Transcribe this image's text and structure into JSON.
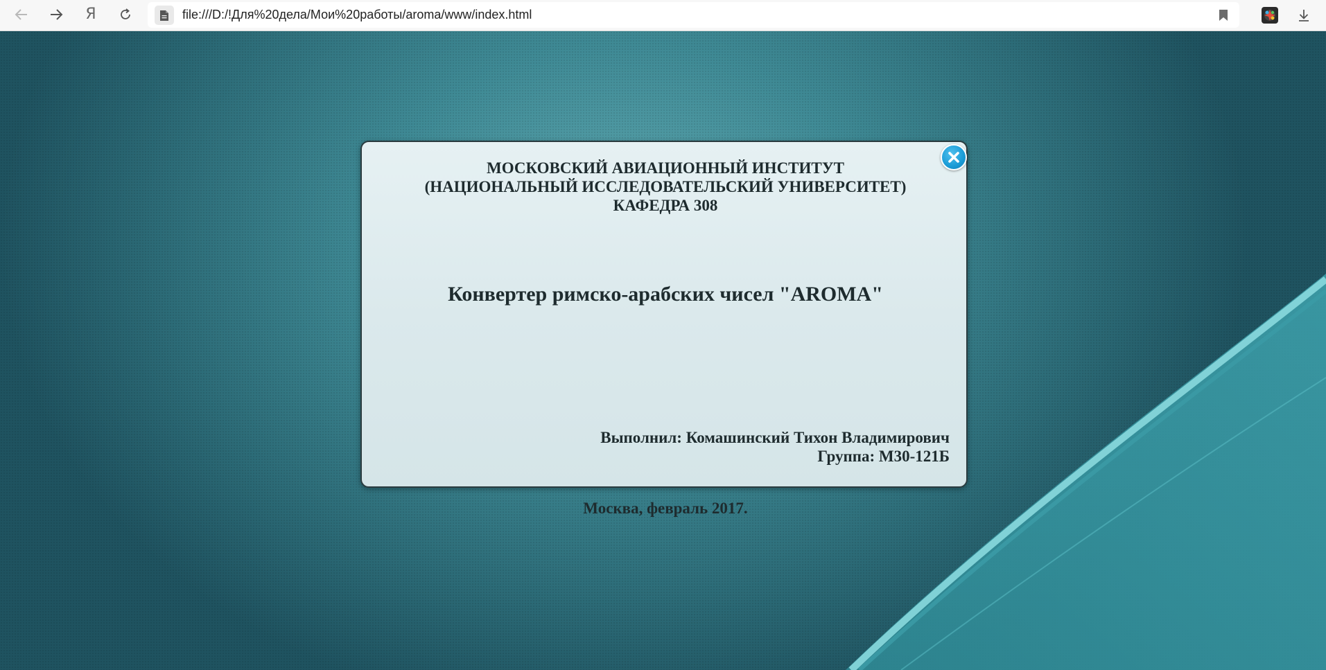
{
  "browser": {
    "url": "file:///D:/!Для%20дела/Мои%20работы/aroma/www/index.html",
    "ya_label": "Я",
    "icons": {
      "back": "arrow-left-icon",
      "forward": "arrow-right-icon",
      "reload": "reload-icon",
      "page": "file-icon",
      "bookmark": "bookmark-icon",
      "extension": "extension-icon",
      "download": "download-icon"
    }
  },
  "card": {
    "institute_line1": "МОСКОВСКИЙ АВИАЦИОННЫЙ ИНСТИТУТ",
    "institute_line2": "(НАЦИОНАЛЬНЫЙ ИССЛЕДОВАТЕЛЬСКИЙ УНИВЕРСИТЕТ)",
    "department": "КАФЕДРА 308",
    "title": "Конвертер римско-арабских чисел \"AROMA\"",
    "author": "Выполнил: Комашинский Тихон Владимирович",
    "group": "Группа: М30-121Б",
    "footer": "Москва, февраль 2017.",
    "close_icon": "close-icon"
  },
  "colors": {
    "background_teal": "#3f8a95",
    "card_bg": "#dbe9ec",
    "close_blue": "#1a9bd6",
    "text_dark": "#1e2b2e"
  }
}
